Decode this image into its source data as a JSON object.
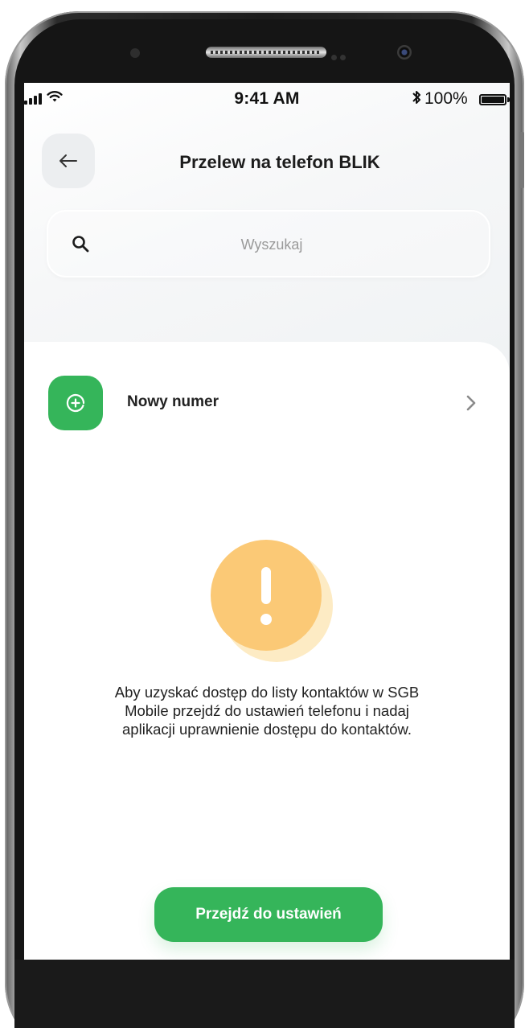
{
  "status_bar": {
    "time": "9:41 AM",
    "battery_percent": "100%",
    "bluetooth_icon": "bluetooth-icon",
    "signal_icon": "signal-icon",
    "wifi_icon": "wifi-icon",
    "battery_icon": "battery-icon"
  },
  "header": {
    "title": "Przelew na telefon BLIK",
    "back_icon": "arrow-left-icon"
  },
  "search": {
    "placeholder": "Wyszukaj",
    "value": "",
    "icon": "search-icon"
  },
  "new_number": {
    "label": "Nowy numer",
    "icon": "plus-circle-icon",
    "chevron_icon": "chevron-right-icon"
  },
  "notice": {
    "icon": "exclamation-icon",
    "lines": [
      "Aby uzyskać dostęp do listy kontaktów w SGB",
      "Mobile przejdź do ustawień telefonu i nadaj",
      "aplikacji uprawnienie dostępu do kontaktów."
    ]
  },
  "action": {
    "settings_button_label": "Przejdź do ustawień"
  },
  "colors": {
    "accent_green": "#35b55a",
    "warning_yellow": "#fbc976",
    "text_dark": "#1c1c1c"
  }
}
